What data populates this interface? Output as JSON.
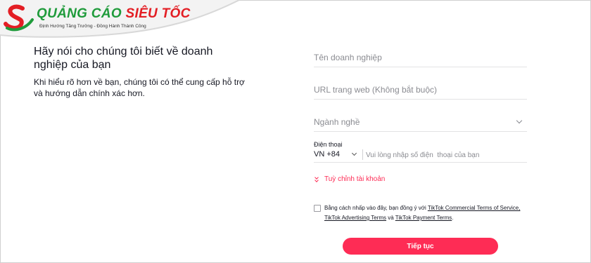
{
  "logo": {
    "title_part1": "QUẢNG CÁO",
    "title_part2": "SIÊU TỐC",
    "tagline": "Định Hướng Tăng Trưởng - Đồng Hành Thành Công"
  },
  "intro": {
    "heading": "Hãy nói cho chúng tôi biết về doanh nghiệp của bạn",
    "description": "Khi hiểu rõ hơn về bạn, chúng tôi có thể cung cấp hỗ trợ và hướng dẫn chính xác hơn."
  },
  "form": {
    "business_name_placeholder": "Tên doanh nghiệp",
    "website_placeholder": "URL trang web (Không bắt buộc)",
    "industry_placeholder": "Ngành nghề",
    "phone_label": "Điện thoại",
    "country_code": "VN +84",
    "phone_placeholder": "Vui lòng nhập số điện  thoại của bạn",
    "customize_account": "Tuỳ chỉnh tài khoản",
    "terms_prefix": "Bằng cách nhấp vào đây, bạn đồng ý với ",
    "terms_link1": "TikTok Commercial Terms of Service,",
    "terms_link2": "TikTok Advertising Terms",
    "terms_and": " và ",
    "terms_link3": "TikTok Payment Terms",
    "terms_suffix": ".",
    "continue_label": "Tiếp tục"
  },
  "colors": {
    "accent": "#fe2c55",
    "logo_green": "#1f9b3b",
    "logo_red": "#e31e24"
  }
}
